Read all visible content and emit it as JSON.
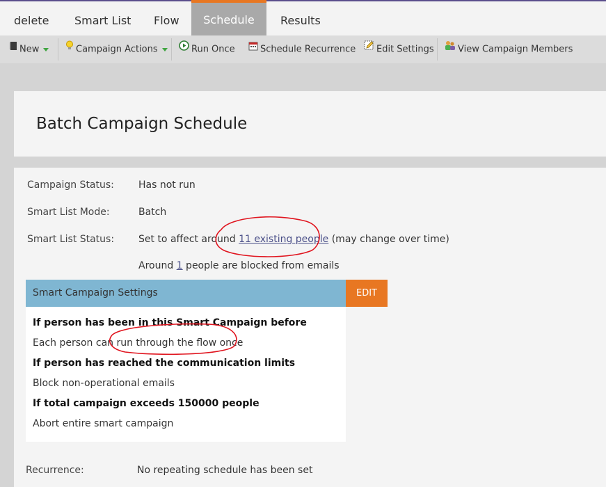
{
  "tabs": [
    {
      "label": "delete"
    },
    {
      "label": "Smart List"
    },
    {
      "label": "Flow"
    },
    {
      "label": "Schedule",
      "active": true
    },
    {
      "label": "Results"
    }
  ],
  "toolbar": {
    "new": "New",
    "campaign_actions": "Campaign Actions",
    "run_once": "Run Once",
    "schedule_recurrence": "Schedule Recurrence",
    "edit_settings": "Edit Settings",
    "view_members": "View Campaign Members"
  },
  "page_title": "Batch Campaign Schedule",
  "details": {
    "campaign_status_label": "Campaign Status:",
    "campaign_status_value": "Has not run",
    "mode_label": "Smart List Mode:",
    "mode_value": "Batch",
    "sl_status_label": "Smart List Status:",
    "sl_status_prefix": "Set to affect around ",
    "sl_status_link": "11 existing people",
    "sl_status_suffix": " (may change over time)",
    "blocked_prefix": "Around ",
    "blocked_link": "1",
    "blocked_suffix": " people are blocked from emails"
  },
  "settings": {
    "header": "Smart Campaign Settings",
    "edit": "EDIT",
    "q1": "If person has been in this Smart Campaign before",
    "a1": "Each person can run through the flow once",
    "q2": "If person has reached the communication limits",
    "a2": "Block non-operational emails",
    "q3": "If total campaign exceeds 150000 people",
    "a3": "Abort entire smart campaign"
  },
  "recurrence": {
    "label": "Recurrence:",
    "value": "No repeating schedule has been set"
  },
  "colors": {
    "accent_orange": "#e87722",
    "settings_header": "#7fb6d2",
    "annotation_red": "#e0141e"
  }
}
